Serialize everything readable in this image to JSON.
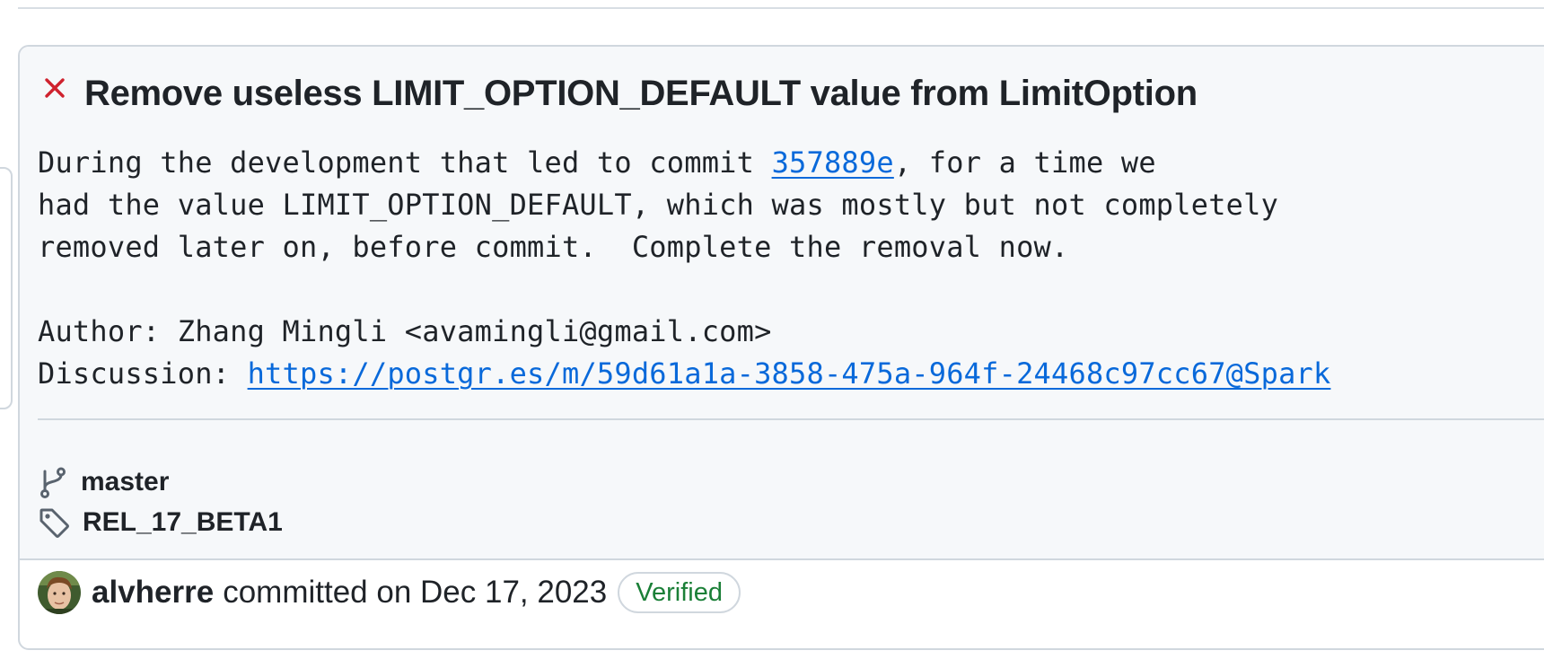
{
  "commit": {
    "status": "failure",
    "status_icon": "x-icon",
    "title": "Remove useless LIMIT_OPTION_DEFAULT value from LimitOption",
    "message": {
      "line1_before_link": "During the development that led to commit ",
      "commit_link": "357889e",
      "line1_after_link": ", for a time we",
      "line2": "had the value LIMIT_OPTION_DEFAULT, which was mostly but not completely",
      "line3": "removed later on, before commit.  Complete the removal now.",
      "author_line": "Author: Zhang Mingli <avamingli@gmail.com>",
      "discussion_label": "Discussion: ",
      "discussion_url": "https://postgr.es/m/59d61a1a-3858-475a-964f-24468c97cc67@Spark"
    },
    "refs": {
      "branch_icon": "git-branch-icon",
      "branch": "master",
      "tag_icon": "tag-icon",
      "tag": "REL_17_BETA1"
    },
    "footer": {
      "author": "alvherre",
      "committed_text": "committed on Dec 17, 2023",
      "verified_label": "Verified"
    }
  },
  "colors": {
    "failure": "#cf222e",
    "link": "#0969da",
    "verified": "#1a7f37",
    "card_bg": "#f6f8fa",
    "border": "#d0d7de",
    "text": "#1f2328"
  }
}
